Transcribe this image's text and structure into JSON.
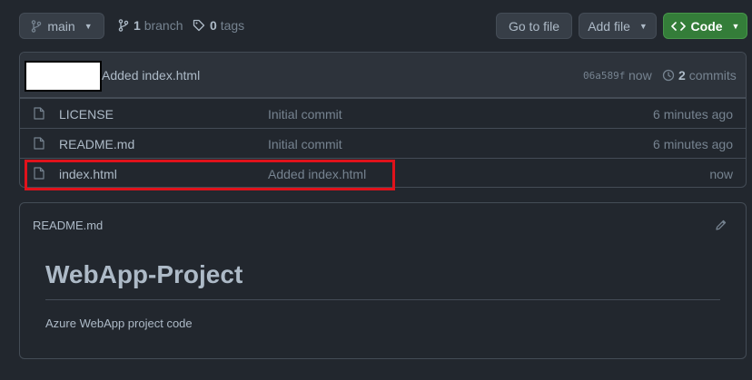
{
  "toolbar": {
    "branch_label": "main",
    "branches_count": "1",
    "branches_label": "branch",
    "tags_count": "0",
    "tags_label": "tags",
    "goto_file_label": "Go to file",
    "add_file_label": "Add file",
    "code_label": "Code"
  },
  "latest_commit": {
    "message": "Added index.html",
    "hash": "06a589f",
    "time": "now",
    "commits_count": "2",
    "commits_label": "commits"
  },
  "files": [
    {
      "name": "LICENSE",
      "message": "Initial commit",
      "age": "6 minutes ago",
      "icon": "file-icon"
    },
    {
      "name": "README.md",
      "message": "Initial commit",
      "age": "6 minutes ago",
      "icon": "file-icon"
    },
    {
      "name": "index.html",
      "message": "Added index.html",
      "age": "now",
      "icon": "file-icon"
    }
  ],
  "readme": {
    "filename": "README.md",
    "title": "WebApp-Project",
    "body": "Azure WebApp project code"
  },
  "colors": {
    "background": "#22272e",
    "border": "#444c56",
    "code_button": "#347d39",
    "highlight": "#e0121b"
  }
}
